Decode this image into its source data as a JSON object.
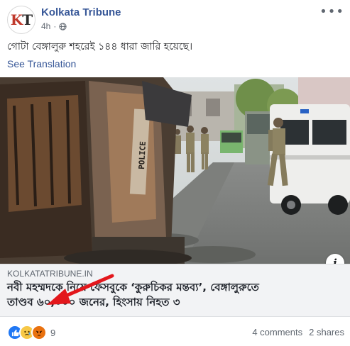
{
  "post": {
    "page_name": "Kolkata Tribune",
    "avatar_initials": {
      "k": "K",
      "t": "T"
    },
    "time": "4h",
    "privacy_icon": "globe-icon",
    "menu_icon": "more-dots-icon",
    "text": "গোটা বেঙ্গালুরু শহরেই ১৪৪ ধারা জারি হয়েছে।",
    "see_translation": "See Translation"
  },
  "link_preview": {
    "domain": "KOLKATATRIBUNE.IN",
    "headline_line1": "নবী মহম্মদকে নিয়ে ফেসবুকে ‘কুরুচিকর মন্তব্য’, বেঙ্গালুরুতে",
    "headline_line2": "তাণ্ডব ৬০,০০০ জনের, হিংসায় নিহত ৩",
    "image_text": "POLICE",
    "info_button": "i",
    "arrow_color": "#e3171c"
  },
  "footer": {
    "reaction_icons": [
      "like-icon",
      "sad-icon",
      "angry-icon"
    ],
    "reaction_count": "9",
    "comments": "4 comments",
    "shares": "2 shares"
  }
}
